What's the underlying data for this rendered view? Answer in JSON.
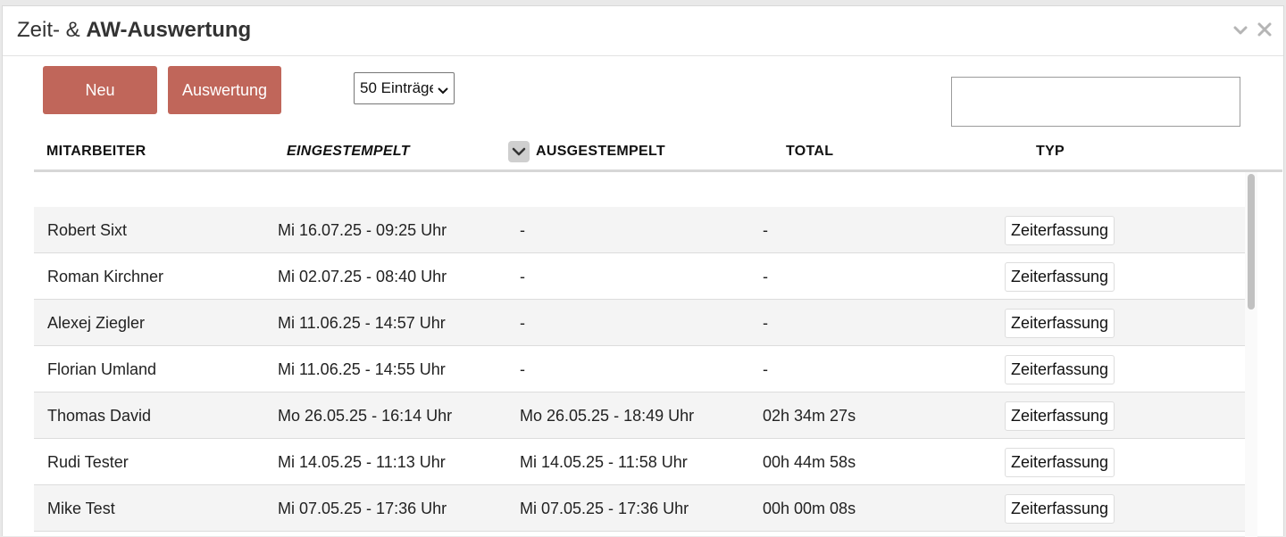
{
  "header": {
    "title_prefix": "Zeit- & ",
    "title_bold": "AW-Auswertung"
  },
  "toolbar": {
    "new_label": "Neu",
    "report_label": "Auswertung",
    "page_size_value": "50 Einträge",
    "search_value": ""
  },
  "table": {
    "columns": {
      "employee": "MITARBEITER",
      "clocked_in": "EINGESTEMPELT",
      "clocked_out": "AUSGESTEMPELT",
      "total": "TOTAL",
      "type": "TYP"
    },
    "rows": [
      {
        "name": "Robert Sixt",
        "in": "Mi 16.07.25 - 09:25 Uhr",
        "out": "-",
        "total": "-",
        "type": "Zeiterfassung"
      },
      {
        "name": "Roman Kirchner",
        "in": "Mi 02.07.25 - 08:40 Uhr",
        "out": "-",
        "total": "-",
        "type": "Zeiterfassung"
      },
      {
        "name": "Alexej Ziegler",
        "in": "Mi 11.06.25 - 14:57 Uhr",
        "out": "-",
        "total": "-",
        "type": "Zeiterfassung"
      },
      {
        "name": "Florian Umland",
        "in": "Mi 11.06.25 - 14:55 Uhr",
        "out": "-",
        "total": "-",
        "type": "Zeiterfassung"
      },
      {
        "name": "Thomas David",
        "in": "Mo 26.05.25 - 16:14 Uhr",
        "out": "Mo 26.05.25 - 18:49 Uhr",
        "total": "02h 34m 27s",
        "type": "Zeiterfassung"
      },
      {
        "name": "Rudi Tester",
        "in": "Mi 14.05.25 - 11:13 Uhr",
        "out": "Mi 14.05.25 - 11:58 Uhr",
        "total": "00h 44m 58s",
        "type": "Zeiterfassung"
      },
      {
        "name": "Mike Test",
        "in": "Mi 07.05.25 - 17:36 Uhr",
        "out": "Mi 07.05.25 - 17:36 Uhr",
        "total": "00h 00m 08s",
        "type": "Zeiterfassung"
      }
    ]
  },
  "colors": {
    "accent": "#c0665a",
    "row_stripe": "#f4f4f4"
  },
  "icons": {
    "collapse": "chevron-down-icon",
    "close": "close-icon",
    "sort": "sort-desc-icon"
  }
}
